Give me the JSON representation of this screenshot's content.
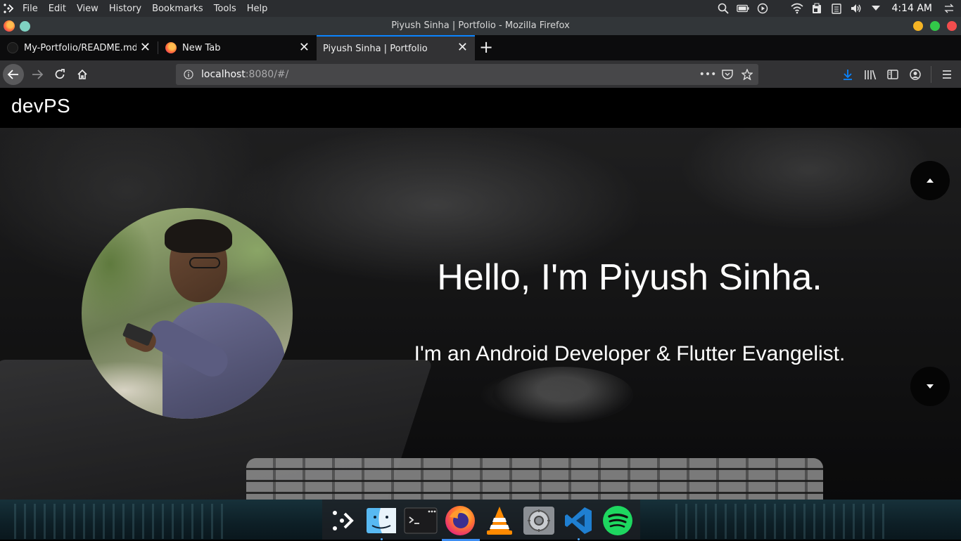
{
  "system_bar": {
    "menu": [
      "File",
      "Edit",
      "View",
      "History",
      "Bookmarks",
      "Tools",
      "Help"
    ],
    "icons": [
      "search-icon",
      "battery-icon",
      "media-play-icon",
      "wifi-icon",
      "clipboard-icon",
      "notes-icon",
      "volume-icon",
      "chevron-down-icon",
      "switch-user-icon"
    ],
    "clock": "4:14 AM"
  },
  "window": {
    "title": "Piyush Sinha | Portfolio - Mozilla Firefox",
    "controls": {
      "minimize": "#f5b424",
      "maximize": "#32c749",
      "close": "#f24d4d"
    }
  },
  "tabs": [
    {
      "label": "My-Portfolio/README.md · ",
      "icon": "github-icon",
      "active": false
    },
    {
      "label": "New Tab",
      "icon": "firefox-icon",
      "active": false
    },
    {
      "label": "Piyush Sinha | Portfolio",
      "icon": "",
      "active": true
    }
  ],
  "navbar": {
    "url_host": "localhost",
    "url_rest": ":8080/#/",
    "icons": [
      "back-icon",
      "forward-icon",
      "reload-icon",
      "home-icon",
      "page-actions-icon",
      "pocket-icon",
      "bookmark-star-icon",
      "download-icon",
      "library-icon",
      "sidebar-icon",
      "account-icon",
      "hamburger-menu-icon"
    ],
    "accent": "#0a84ff"
  },
  "site": {
    "brand": "devPS",
    "hero_title": "Hello, I'm Piyush Sinha.",
    "hero_subtitle": "I'm an Android Developer & Flutter Evangelist."
  },
  "dock": {
    "apps": [
      "launchpad-icon",
      "finder-icon",
      "terminal-icon",
      "firefox-icon",
      "vlc-icon",
      "settings-icon",
      "vscode-icon",
      "spotify-icon"
    ]
  }
}
